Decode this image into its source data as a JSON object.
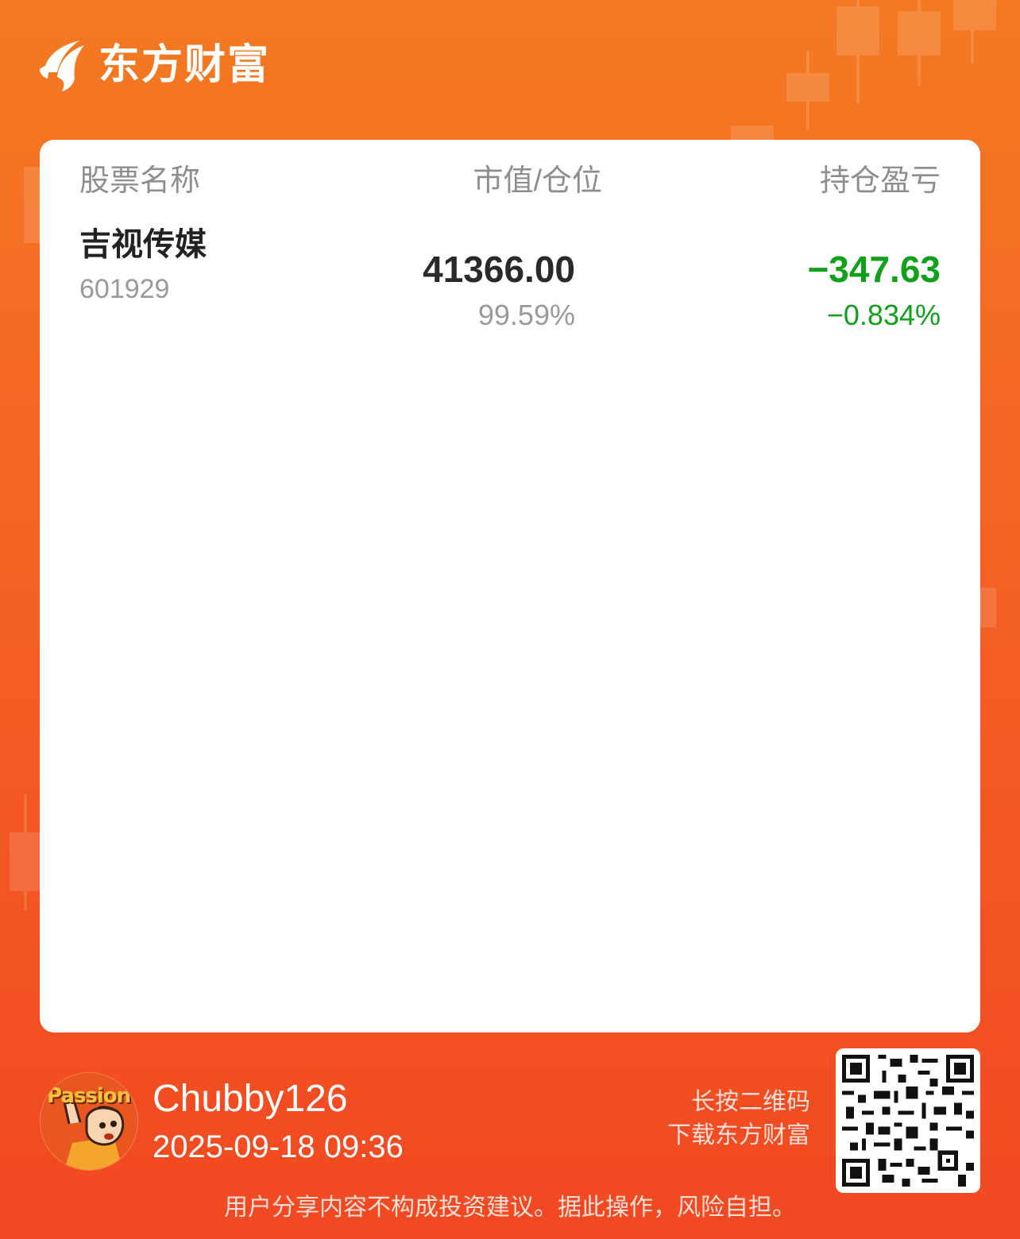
{
  "app": {
    "brand": "东方财富",
    "accent": "#f46224",
    "loss_color": "#11a01a"
  },
  "table": {
    "headers": {
      "name": "股票名称",
      "value": "市值/仓位",
      "pl": "持仓盈亏"
    },
    "rows": [
      {
        "name": "吉视传媒",
        "code": "601929",
        "market_value": "41366.00",
        "position": "99.59%",
        "pl": "−347.63",
        "pl_pct": "−0.834%"
      }
    ]
  },
  "footer": {
    "avatar_text": "Passion",
    "username": "Chubby126",
    "datetime": "2025-09-18 09:36",
    "qr_hint_line1": "长按二维码",
    "qr_hint_line2": "下载东方财富",
    "disclaimer": "用户分享内容不构成投资建议。据此操作，风险自担。"
  }
}
